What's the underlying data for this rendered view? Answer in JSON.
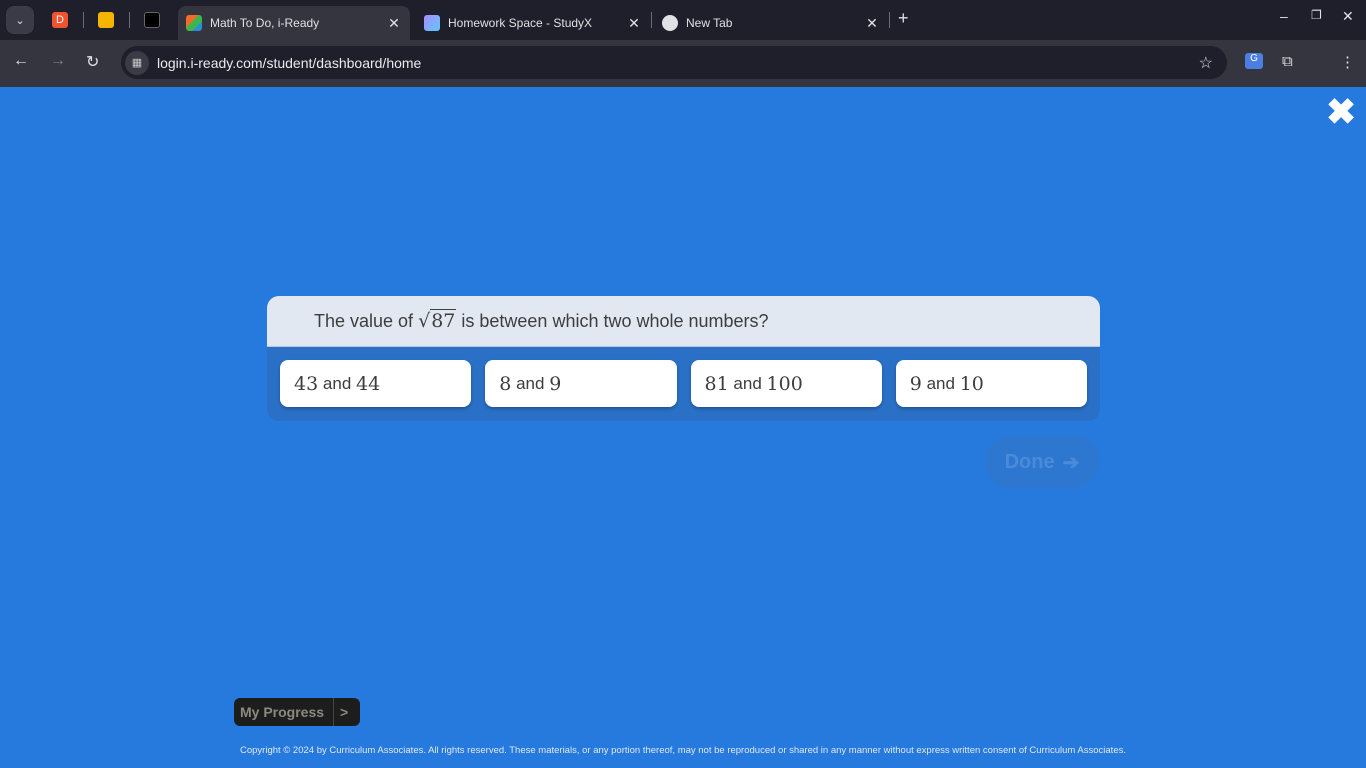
{
  "browser": {
    "tabs": [
      {
        "title": "Math To Do, i-Ready",
        "active": true,
        "icon": "iready-cube-icon"
      },
      {
        "title": "Homework Space - StudyX",
        "active": false,
        "icon": "studyx-gem-icon"
      },
      {
        "title": "New Tab",
        "active": false,
        "icon": "chrome-icon"
      }
    ],
    "pinned_tabs": [
      {
        "icon": "d-app-icon",
        "color": "#f0532d",
        "letter": "D"
      },
      {
        "icon": "slides-icon",
        "color": "#f5b400"
      },
      {
        "icon": "openai-icon",
        "color": "#000000"
      }
    ],
    "url": "login.i-ready.com/student/dashboard/home"
  },
  "question": {
    "prefix": "The value of",
    "radicand": "87",
    "suffix": "is between which two whole numbers?"
  },
  "answers": [
    {
      "a": "43",
      "b": "44"
    },
    {
      "a": "8",
      "b": "9"
    },
    {
      "a": "81",
      "b": "100"
    },
    {
      "a": "9",
      "b": "10"
    }
  ],
  "and_word": "and",
  "done_label": "Done",
  "my_progress": {
    "label": "My Progress",
    "arrow": ">"
  },
  "copyright": "Copyright © 2024 by Curriculum Associates. All rights reserved. These materials, or any portion thereof, may not be reproduced or shared in any manner without express written consent of Curriculum Associates.",
  "colors": {
    "background": "#277add",
    "question_header": "#e1e8f2",
    "answer_area": "#2a70c6"
  }
}
